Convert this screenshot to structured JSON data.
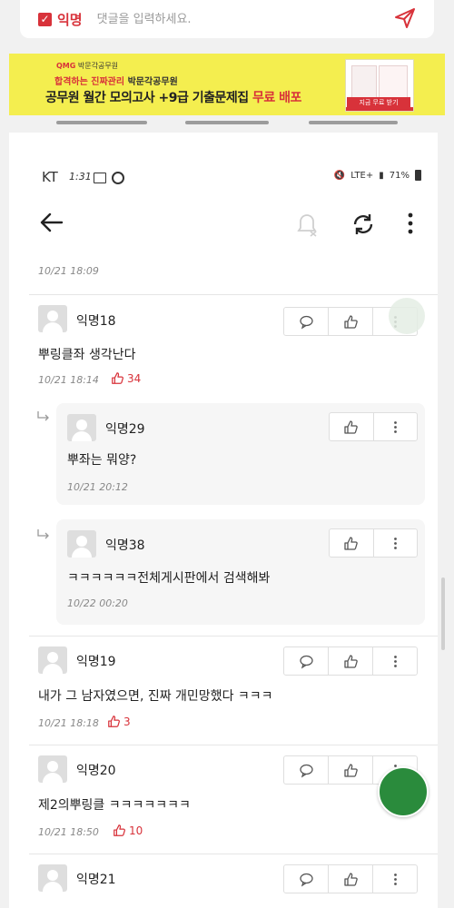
{
  "input_bar": {
    "anonymous_label": "익명",
    "placeholder": "댓글을 입력하세요."
  },
  "ad": {
    "brand_prefix": "QMG",
    "brand_name": "박문각공무원",
    "line1_red": "합격하는 진짜관리",
    "line1_rest": "박문각공무원",
    "line2_main": "공무원 월간 모의고사 +9급 기출문제집",
    "line2_red": "무료 배포",
    "cta": "지금 무료 받기"
  },
  "phone_status": {
    "carrier": "KT",
    "time": "1:31",
    "right_text": "LTE+",
    "battery": "71%"
  },
  "first_date": "10/21 18:09",
  "comments": [
    {
      "name": "익명18",
      "text": "뿌링클좌 생각난다",
      "date": "10/21 18:14",
      "likes": "34",
      "replies": [
        {
          "name": "익명29",
          "text": "뿌좌는 뭐양?",
          "date": "10/21 20:12"
        },
        {
          "name": "익명38",
          "text": "ㅋㅋㅋㅋㅋㅋ전체게시판에서 검색해봐",
          "date": "10/22 00:20"
        }
      ]
    },
    {
      "name": "익명19",
      "text": "내가 그 남자였으면, 진짜 개민망했다 ㅋㅋㅋ",
      "date": "10/21 18:18",
      "likes": "3"
    },
    {
      "name": "익명20",
      "text": "제2의뿌링클 ㅋㅋㅋㅋㅋㅋㅋ",
      "date": "10/21 18:50",
      "likes": "10"
    },
    {
      "name": "익명21",
      "text": ""
    }
  ],
  "colors": {
    "accent": "#d8323a",
    "ad_background": "#f4ee4f",
    "reply_background": "#f6f6f6"
  },
  "icons": [
    "send-icon",
    "back-arrow-icon",
    "bell-off-icon",
    "refresh-icon",
    "more-vertical-icon",
    "comment-icon",
    "thumbs-up-icon",
    "reply-arrow-icon"
  ]
}
